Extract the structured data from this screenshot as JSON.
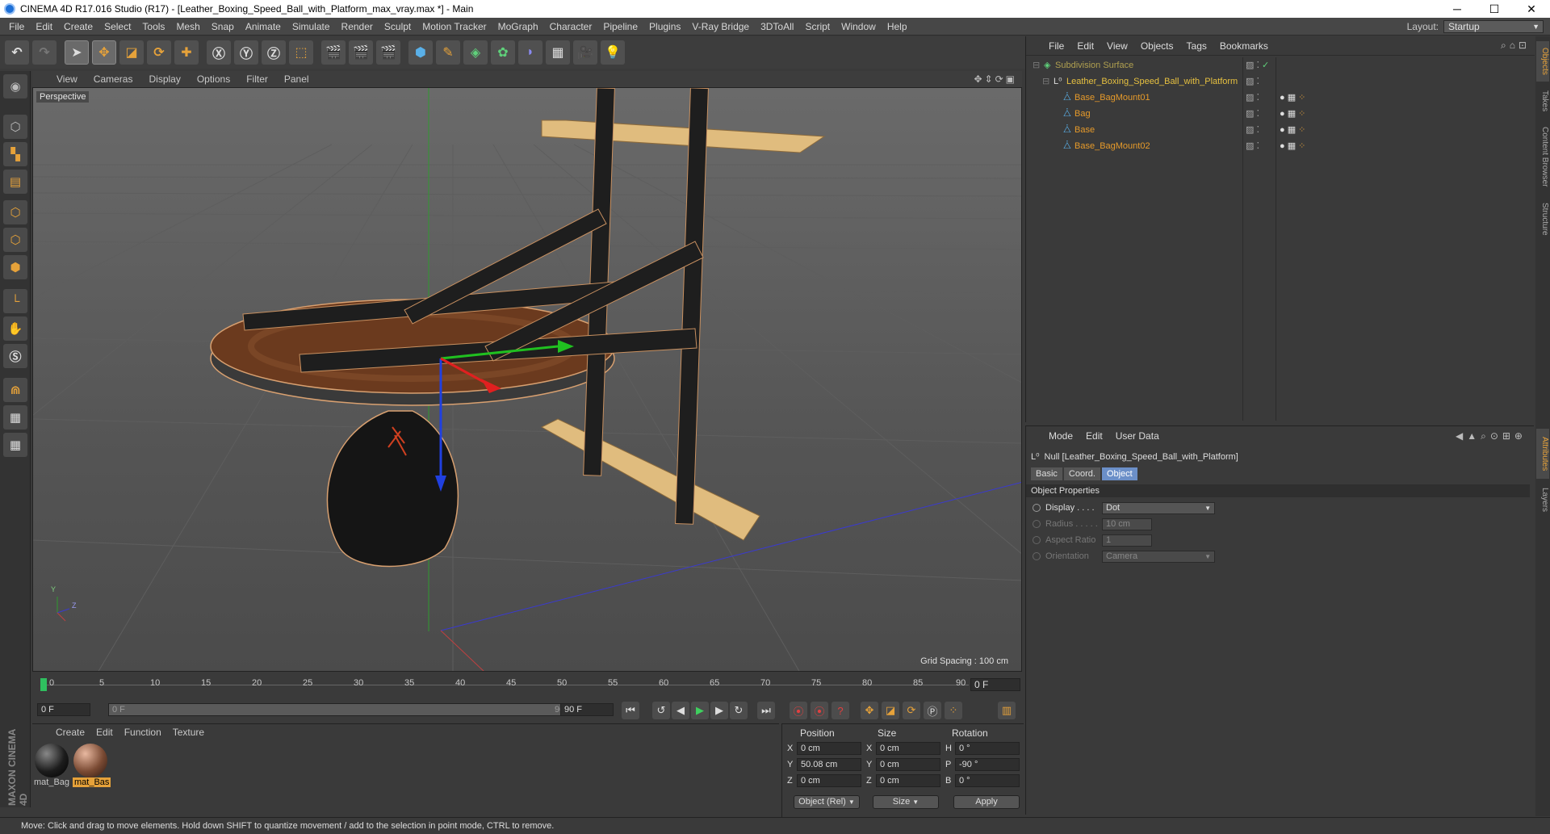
{
  "window": {
    "title": "CINEMA 4D R17.016 Studio (R17) - [Leather_Boxing_Speed_Ball_with_Platform_max_vray.max *] - Main",
    "minimize": "─",
    "maximize": "☐",
    "close": "✕"
  },
  "menu": [
    "File",
    "Edit",
    "Create",
    "Select",
    "Tools",
    "Mesh",
    "Snap",
    "Animate",
    "Simulate",
    "Render",
    "Sculpt",
    "Motion Tracker",
    "MoGraph",
    "Character",
    "Pipeline",
    "Plugins",
    "V-Ray Bridge",
    "3DToAll",
    "Script",
    "Window",
    "Help"
  ],
  "layout": {
    "label": "Layout:",
    "value": "Startup"
  },
  "viewport": {
    "menu": [
      "View",
      "Cameras",
      "Display",
      "Options",
      "Filter",
      "Panel"
    ],
    "label": "Perspective",
    "grid_spacing": "Grid Spacing : 100 cm",
    "axis_y": "Y",
    "axis_z": "Z"
  },
  "timeline": {
    "ticks": [
      "0",
      "5",
      "10",
      "15",
      "20",
      "25",
      "30",
      "35",
      "40",
      "45",
      "50",
      "55",
      "60",
      "65",
      "70",
      "75",
      "80",
      "85",
      "90"
    ],
    "frame_box": "0 F",
    "start": "0 F",
    "slider_start": "0 F",
    "slider_end": "90 F",
    "end": "90 F"
  },
  "materials": {
    "menu": [
      "Create",
      "Edit",
      "Function",
      "Texture"
    ],
    "items": [
      {
        "label": "mat_Bag",
        "color": "#1c1c1c"
      },
      {
        "label": "mat_Bas",
        "color": "#7a4a33"
      }
    ]
  },
  "coords": {
    "headers": [
      "Position",
      "Size",
      "Rotation"
    ],
    "rows": [
      {
        "axis": "X",
        "pos": "0 cm",
        "saxis": "X",
        "size": "0 cm",
        "raxis": "H",
        "rot": "0 °"
      },
      {
        "axis": "Y",
        "pos": "50.08 cm",
        "saxis": "Y",
        "size": "0 cm",
        "raxis": "P",
        "rot": "-90 °"
      },
      {
        "axis": "Z",
        "pos": "0 cm",
        "saxis": "Z",
        "size": "0 cm",
        "raxis": "B",
        "rot": "0 °"
      }
    ],
    "mode": "Object (Rel)",
    "size_mode": "Size",
    "apply": "Apply"
  },
  "status": "Move: Click and drag to move elements. Hold down SHIFT to quantize movement / add to the selection in point mode, CTRL to remove.",
  "objects": {
    "menu": [
      "File",
      "Edit",
      "View",
      "Objects",
      "Tags",
      "Bookmarks"
    ],
    "tree": [
      {
        "name": "Subdivision Surface",
        "indent": 0
      },
      {
        "name": "Leather_Boxing_Speed_Ball_with_Platform",
        "indent": 1
      },
      {
        "name": "Base_BagMount01",
        "indent": 2
      },
      {
        "name": "Bag",
        "indent": 2
      },
      {
        "name": "Base",
        "indent": 2
      },
      {
        "name": "Base_BagMount02",
        "indent": 2
      }
    ]
  },
  "attributes": {
    "menu": [
      "Mode",
      "Edit",
      "User Data"
    ],
    "title": "Null [Leather_Boxing_Speed_Ball_with_Platform]",
    "tabs": [
      "Basic",
      "Coord.",
      "Object"
    ],
    "section": "Object Properties",
    "props": [
      {
        "label": "Display . . . .",
        "value": "Dot"
      },
      {
        "label": "Radius . . . . .",
        "value": "10 cm"
      },
      {
        "label": "Aspect Ratio",
        "value": "1"
      },
      {
        "label": "Orientation",
        "value": "Camera"
      }
    ]
  },
  "right_tabs": [
    "Objects",
    "Takes",
    "Content Browser",
    "Structure",
    "Attributes",
    "Layers"
  ],
  "logo": "MAXON CINEMA 4D"
}
